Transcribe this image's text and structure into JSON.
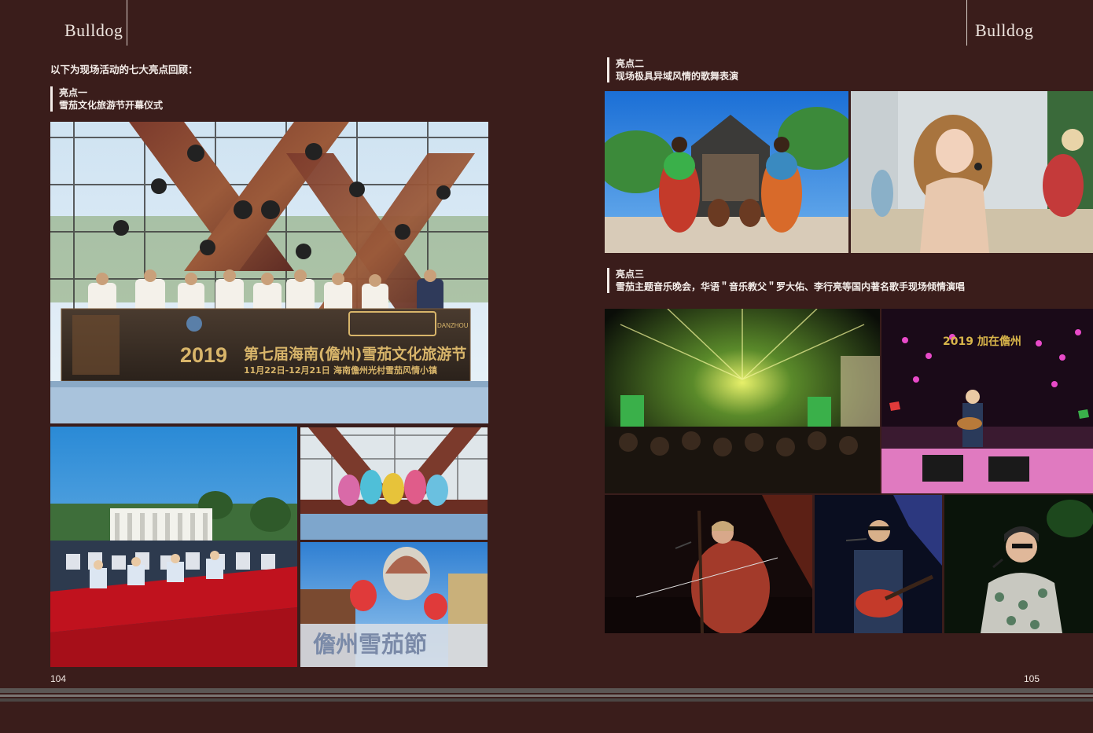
{
  "header": {
    "brand_left": "Bulldog",
    "brand_right": "Bulldog"
  },
  "left_page": {
    "intro": "以下为现场活动的七大亮点回顾：",
    "section1": {
      "title": "亮点一",
      "subtitle": "雪茄文化旅游节开幕仪式"
    },
    "photo1_banner": {
      "year": "2019",
      "title": "第七届海南(儋州)雪茄文化旅游节",
      "dates": "11月22日-12月21日",
      "venue": "海南儋州光村雪茄风情小镇",
      "logo_sub": "DANZHOU"
    },
    "photo4_sign": "儋州雪茄節",
    "page_number": "104"
  },
  "right_page": {
    "section2": {
      "title": "亮点二",
      "subtitle": "现场极具异域风情的歌舞表演"
    },
    "section3": {
      "title": "亮点三",
      "subtitle": "雪茄主题音乐晚会，华语＂音乐教父＂罗大佑、李行亮等国内著名歌手现场倾情演唱"
    },
    "photo8_sign": "2019 加在儋州",
    "page_number": "105"
  },
  "colors": {
    "background": "#3a1d1b",
    "text": "#f4ede9",
    "banner_gold": "#d8b56a"
  }
}
